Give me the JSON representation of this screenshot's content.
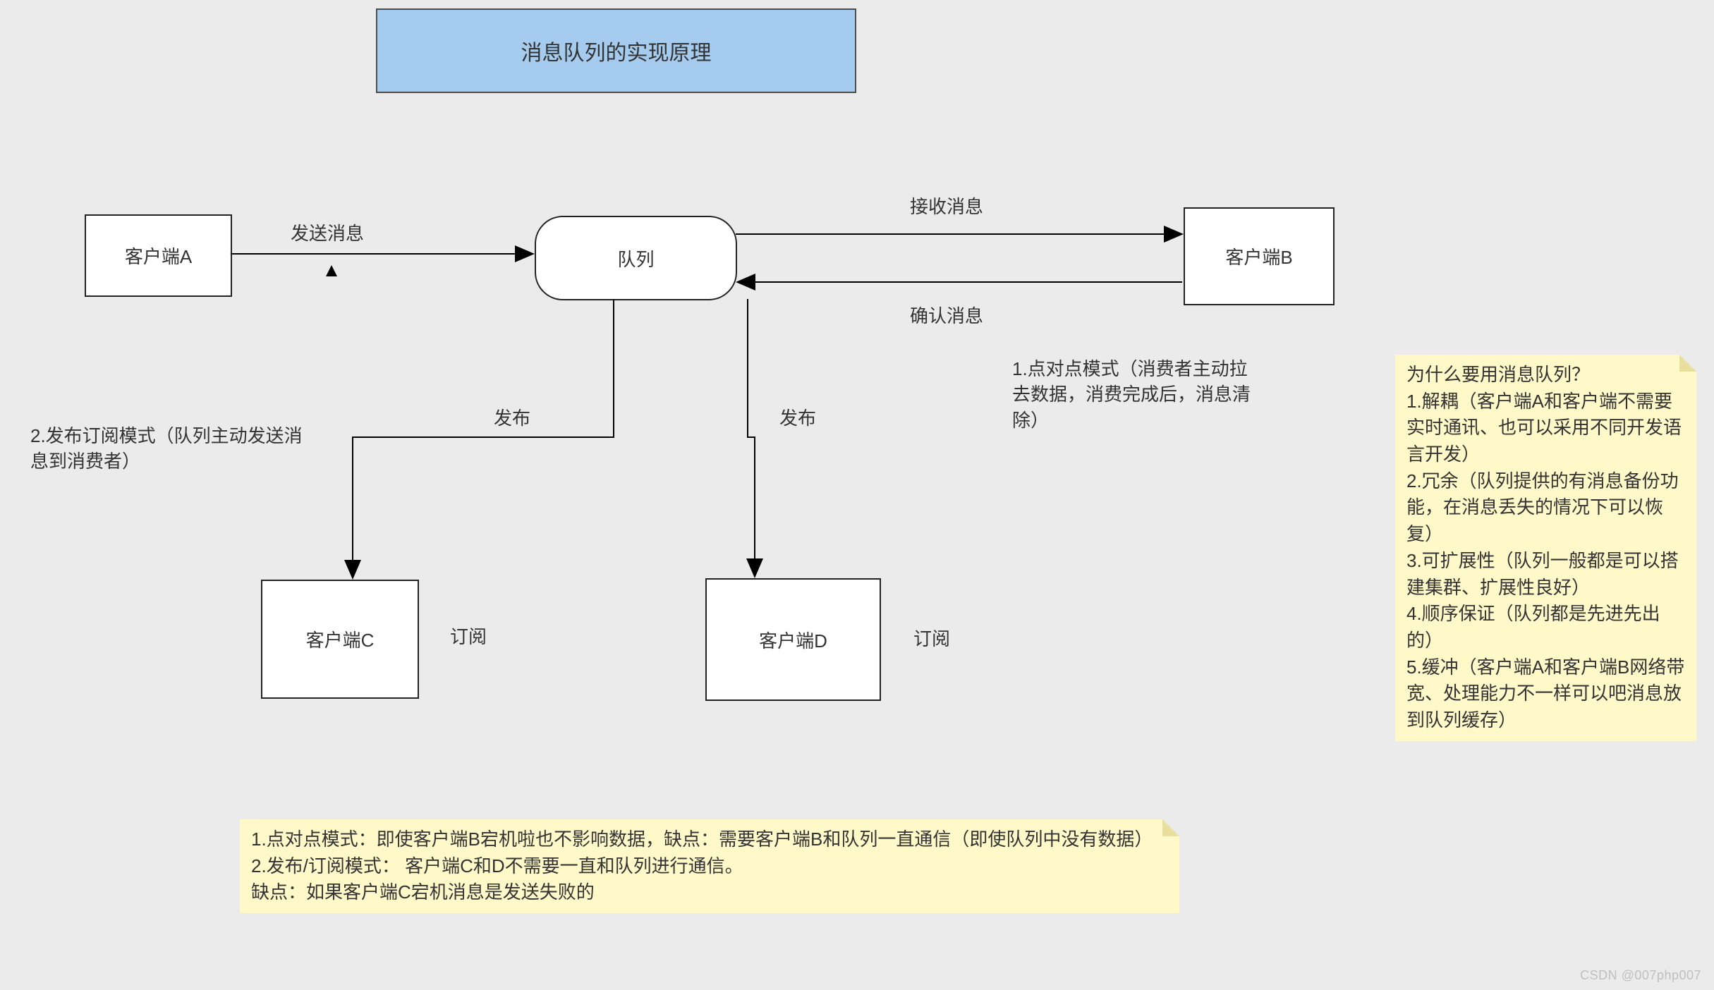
{
  "title": "消息队列的实现原理",
  "nodes": {
    "clientA": "客户端A",
    "queue": "队列",
    "clientB": "客户端B",
    "clientC": "客户端C",
    "clientD": "客户端D"
  },
  "edgeLabels": {
    "send": "发送消息",
    "receive": "接收消息",
    "ack": "确认消息",
    "publish1": "发布",
    "publish2": "发布",
    "subscribeC": "订阅",
    "subscribeD": "订阅"
  },
  "annotations": {
    "mode1": "1.点对点模式（消费者主动拉去数据，消费完成后，消息清除）",
    "mode2": "2.发布订阅模式（队列主动发送消息到消费者）"
  },
  "note_right": {
    "line0": "为什么要用消息队列？",
    "line1": "1.解耦（客户端A和客户端不需要实时通讯、也可以采用不同开发语言开发）",
    "line2": "2.冗余（队列提供的有消息备份功能，在消息丢失的情况下可以恢复）",
    "line3": "3.可扩展性（队列一般都是可以搭建集群、扩展性良好）",
    "line4": "4.顺序保证（队列都是先进先出的）",
    "line5": "5.缓冲（客户端A和客户端B网络带宽、处理能力不一样可以吧消息放到队列缓存）"
  },
  "note_bottom": {
    "line1": "1.点对点模式：即使客户端B宕机啦也不影响数据，缺点：需要客户端B和队列一直通信（即使队列中没有数据）",
    "line2": "2.发布/订阅模式：    客户端C和D不需要一直和队列进行通信。",
    "line3": "缺点：如果客户端C宕机消息是发送失败的"
  },
  "watermark": "CSDN @007php007",
  "colors": {
    "titleBg": "#a5cbee",
    "noteBg": "#fff8c8",
    "pageBg": "#ebebeb"
  }
}
